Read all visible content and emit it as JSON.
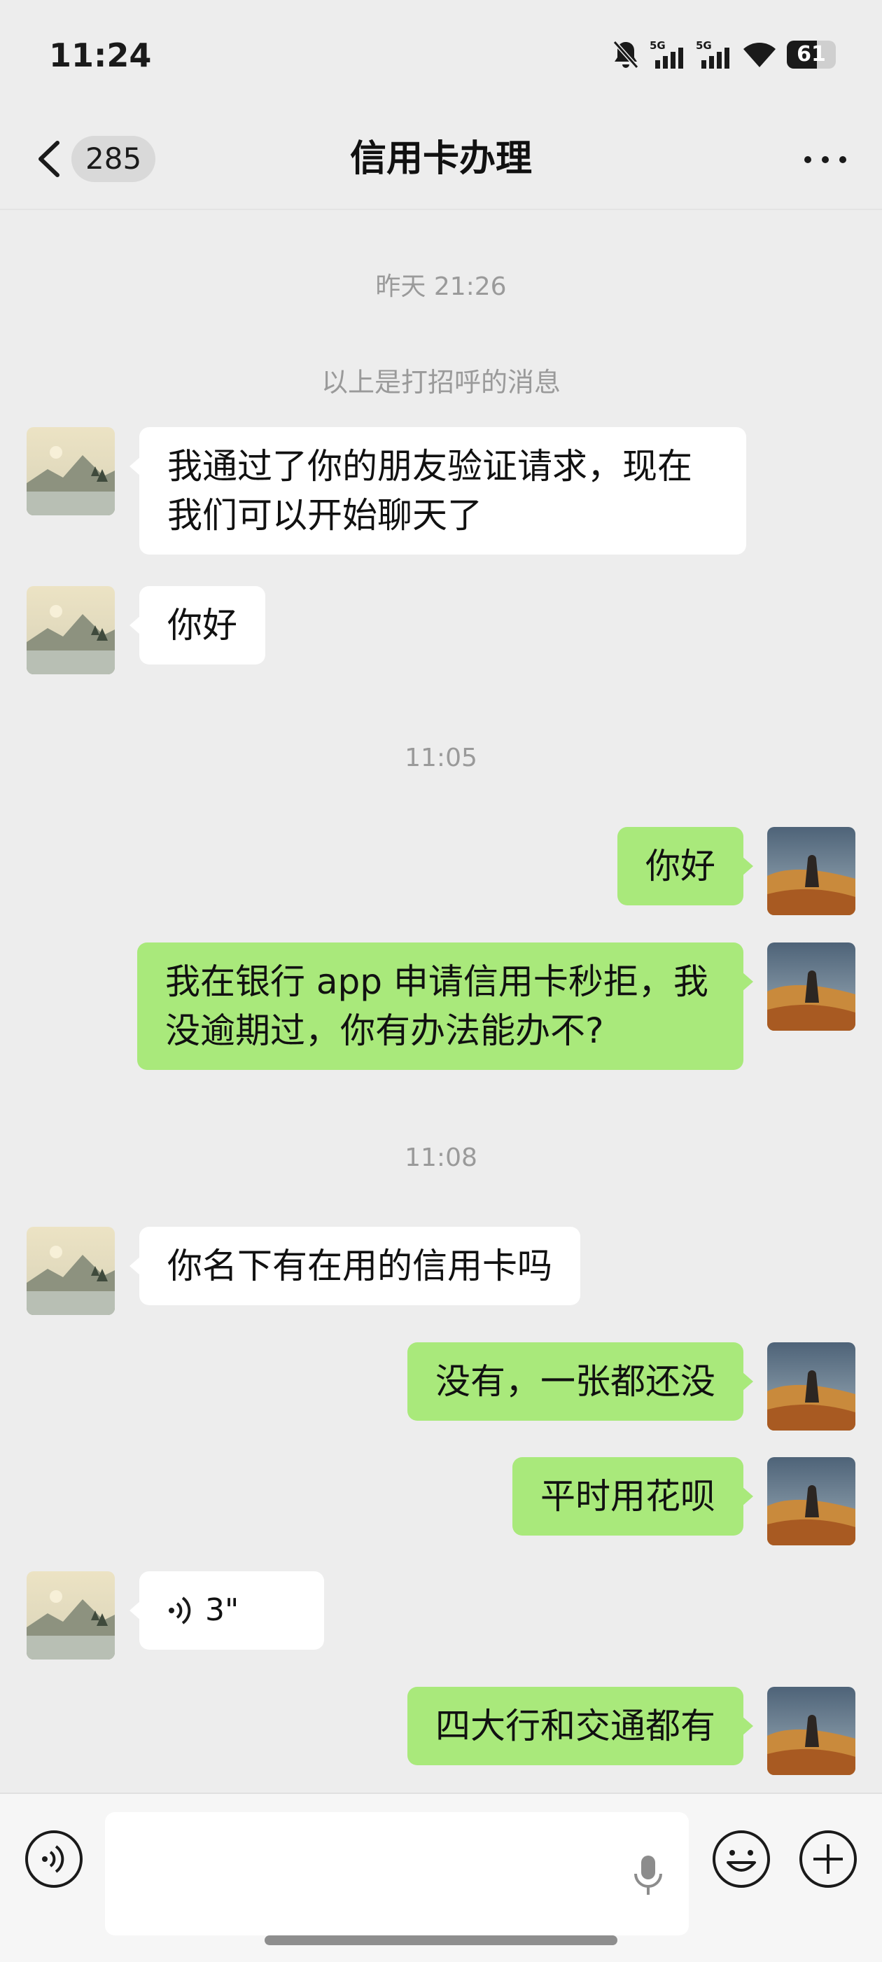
{
  "status_bar": {
    "time": "11:24",
    "signal_1_label": "5G",
    "signal_2_label": "5G",
    "battery_level": "61",
    "battery_percent": 61,
    "icons": [
      "mute-bell-icon",
      "signal-5g-icon",
      "signal-5g-icon",
      "wifi-icon",
      "battery-icon"
    ]
  },
  "header": {
    "unread_count": "285",
    "title": "信用卡办理",
    "back_icon": "chevron-left-icon",
    "more_icon": "more-dots-icon"
  },
  "messages": {
    "ts1": "昨天 21:26",
    "system_note": "以上是打招呼的消息",
    "m1": [
      "我通过了你的朋友验证请求，现在",
      "我们可以开始聊天了"
    ],
    "m2": "你好",
    "ts2": "11:05",
    "m3": "你好",
    "m4": [
      "我在银行 app 申请信用卡秒拒，我",
      "没逾期过，你有办法能办不?"
    ],
    "ts3": "11:08",
    "m5": "你名下有在用的信用卡吗",
    "m6": "没有，一张都还没",
    "m7": "平时用花呗",
    "m8_voice_duration": "3\"",
    "m9": "四大行和交通都有"
  },
  "input_bar": {
    "placeholder": "",
    "icons": [
      "voice-mode-icon",
      "microphone-icon",
      "emoji-icon",
      "plus-icon"
    ]
  },
  "colors": {
    "background": "#ededed",
    "bubble_incoming": "#ffffff",
    "bubble_outgoing": "#a9e97b",
    "timestamp_text": "#9a9a9a"
  }
}
